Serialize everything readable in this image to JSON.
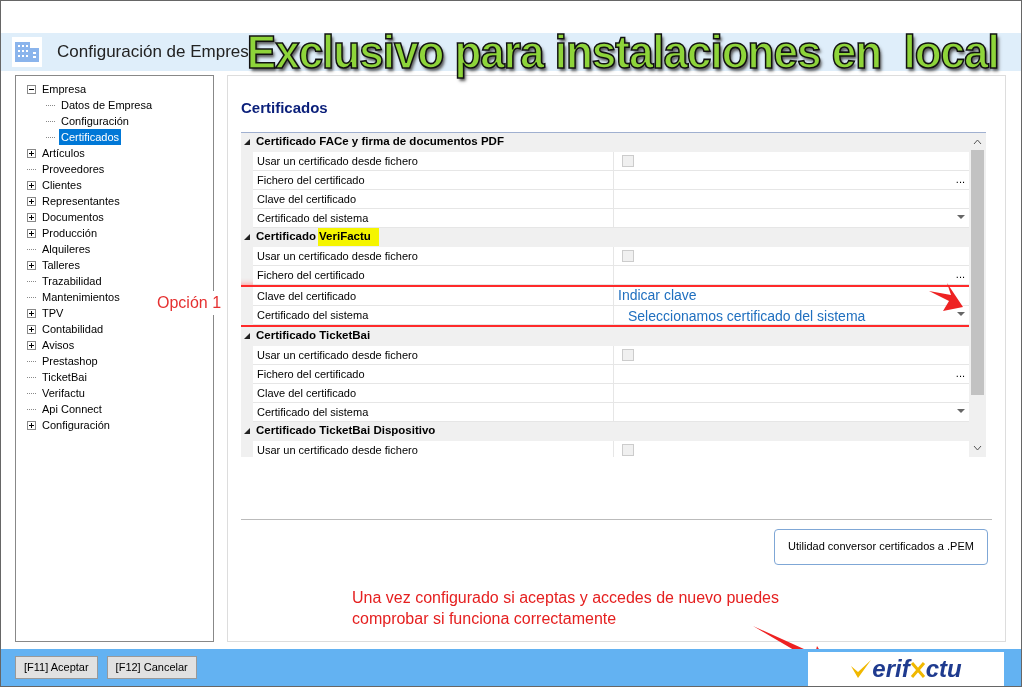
{
  "window": {
    "title": "Configuración de Empres"
  },
  "banner": "Exclusivo para instalaciones en  local",
  "tree": [
    {
      "label": "Empresa",
      "expandable": true,
      "expanded": true,
      "selected": false,
      "children": [
        {
          "label": "Datos de Empresa",
          "expandable": false,
          "selected": false
        },
        {
          "label": "Configuración",
          "expandable": false,
          "selected": false
        },
        {
          "label": "Certificados",
          "expandable": false,
          "selected": true
        }
      ]
    },
    {
      "label": "Artículos",
      "expandable": true,
      "expanded": false,
      "selected": false
    },
    {
      "label": "Proveedores",
      "expandable": false,
      "selected": false
    },
    {
      "label": "Clientes",
      "expandable": true,
      "expanded": false,
      "selected": false
    },
    {
      "label": "Representantes",
      "expandable": true,
      "expanded": false,
      "selected": false
    },
    {
      "label": "Documentos",
      "expandable": true,
      "expanded": false,
      "selected": false
    },
    {
      "label": "Producción",
      "expandable": true,
      "expanded": false,
      "selected": false
    },
    {
      "label": "Alquileres",
      "expandable": false,
      "selected": false
    },
    {
      "label": "Talleres",
      "expandable": true,
      "expanded": false,
      "selected": false
    },
    {
      "label": "Trazabilidad",
      "expandable": false,
      "selected": false
    },
    {
      "label": "Mantenimientos",
      "expandable": false,
      "selected": false
    },
    {
      "label": "TPV",
      "expandable": true,
      "expanded": false,
      "selected": false
    },
    {
      "label": "Contabilidad",
      "expandable": true,
      "expanded": false,
      "selected": false
    },
    {
      "label": "Avisos",
      "expandable": true,
      "expanded": false,
      "selected": false
    },
    {
      "label": "Prestashop",
      "expandable": false,
      "selected": false
    },
    {
      "label": "TicketBai",
      "expandable": false,
      "selected": false
    },
    {
      "label": "Verifactu",
      "expandable": false,
      "selected": false
    },
    {
      "label": "Api Connect",
      "expandable": false,
      "selected": false
    },
    {
      "label": "Configuración",
      "expandable": true,
      "expanded": false,
      "selected": false
    }
  ],
  "panel": {
    "title": "Certificados",
    "sections": [
      {
        "title": "Certificado FACe y firma de documentos PDF",
        "expanded": true,
        "rows": [
          {
            "kind": "checkbox",
            "label": "Usar un certificado desde fichero",
            "checked": false
          },
          {
            "kind": "file",
            "label": "Fichero del certificado",
            "button": "..."
          },
          {
            "kind": "text",
            "label": "Clave del certificado"
          },
          {
            "kind": "dropdown",
            "label": "Certificado del sistema"
          }
        ]
      },
      {
        "title": "Certificado",
        "highlight": "VeriFactu",
        "expanded": true,
        "rows": [
          {
            "kind": "checkbox",
            "label": "Usar un certificado desde fichero",
            "checked": false
          },
          {
            "kind": "file",
            "label": "Fichero del certificado",
            "button": "..."
          },
          {
            "kind": "text",
            "label": "Clave del certificado",
            "note": "Indicar clave",
            "marked": true
          },
          {
            "kind": "dropdown",
            "label": "Certificado del sistema",
            "note": "Seleccionamos certificado del sistema",
            "marked": true
          }
        ]
      },
      {
        "title": "Certificado TicketBai",
        "expanded": true,
        "rows": [
          {
            "kind": "checkbox",
            "label": "Usar un certificado desde fichero",
            "checked": false
          },
          {
            "kind": "file",
            "label": "Fichero del certificado",
            "button": "..."
          },
          {
            "kind": "text",
            "label": "Clave del certificado"
          },
          {
            "kind": "dropdown",
            "label": "Certificado del sistema"
          }
        ]
      },
      {
        "title": "Certificado TicketBai Dispositivo",
        "expanded": true,
        "rows": [
          {
            "kind": "checkbox",
            "label": "Usar un certificado desde fichero",
            "checked": false
          }
        ]
      }
    ],
    "convert_button": "Utilidad conversor certificados a .PEM"
  },
  "option_label": "Opción 1",
  "footer_note": "Una vez configurado si aceptas y accedes de nuevo puedes comprobar si funciona correctamente",
  "buttons": [
    "[F11] Aceptar",
    "[F12] Cancelar"
  ],
  "logo": {
    "before": "erif",
    "after": "ctu"
  }
}
